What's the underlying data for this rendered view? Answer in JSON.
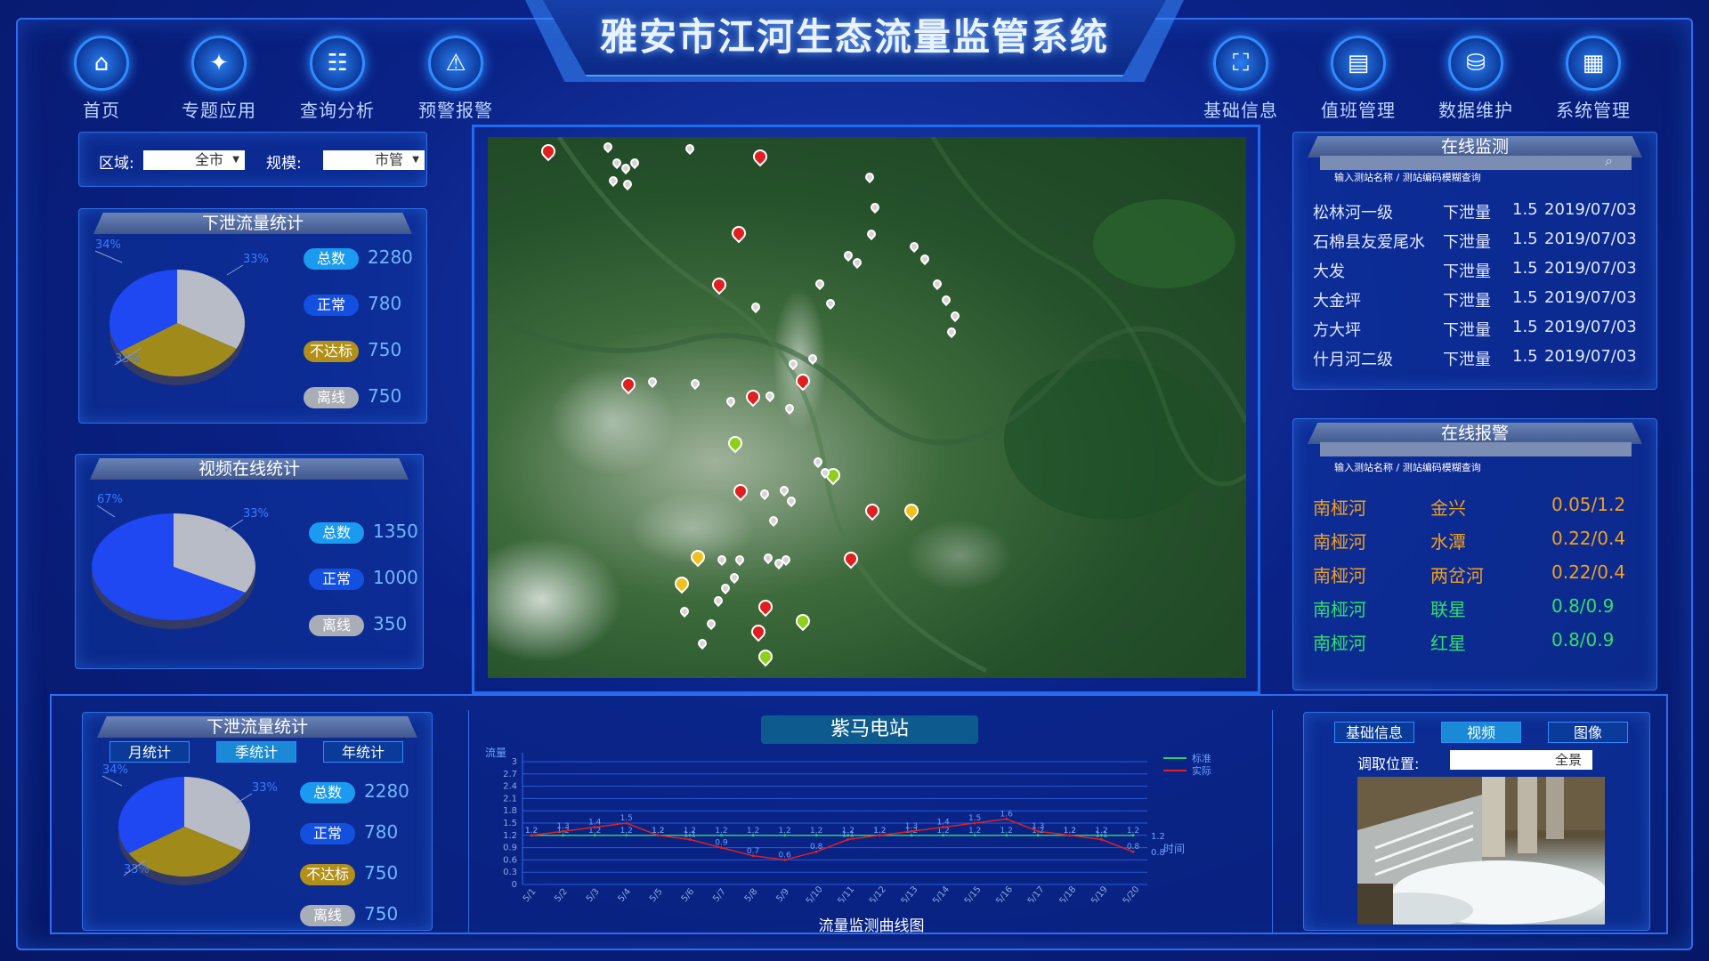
{
  "app": {
    "title": "雅安市江河生态流量监管系统"
  },
  "nav_left": [
    {
      "label": "首页",
      "icon": "home-icon",
      "glyph": "⌂"
    },
    {
      "label": "专题应用",
      "icon": "topic-icon",
      "glyph": "✦"
    },
    {
      "label": "查询分析",
      "icon": "query-icon",
      "glyph": "☷"
    },
    {
      "label": "预警报警",
      "icon": "alarm-icon",
      "glyph": "⚠"
    }
  ],
  "nav_right": [
    {
      "label": "基础信息",
      "icon": "info-icon",
      "glyph": "⛶"
    },
    {
      "label": "值班管理",
      "icon": "duty-icon",
      "glyph": "▤"
    },
    {
      "label": "数据维护",
      "icon": "database-icon",
      "glyph": "⛁"
    },
    {
      "label": "系统管理",
      "icon": "system-icon",
      "glyph": "▦"
    }
  ],
  "filter": {
    "region_label": "区域:",
    "region_value": "全市",
    "scale_label": "规模:",
    "scale_value": "市管"
  },
  "discharge": {
    "title": "下泄流量统计",
    "items": [
      {
        "label": "总数",
        "value": "2280"
      },
      {
        "label": "正常",
        "value": "780"
      },
      {
        "label": "不达标",
        "value": "750"
      },
      {
        "label": "离线",
        "value": "750"
      }
    ],
    "pie_labels": [
      "34%",
      "33%",
      "33%"
    ]
  },
  "video": {
    "title": "视频在线统计",
    "items": [
      {
        "label": "总数",
        "value": "1350"
      },
      {
        "label": "正常",
        "value": "1000"
      },
      {
        "label": "离线",
        "value": "350"
      }
    ],
    "pie_labels": [
      "67%",
      "33%"
    ]
  },
  "online_monitor": {
    "title": "在线监测",
    "search_placeholder": "输入测站名称 / 测站编码模糊查询",
    "rows": [
      {
        "station": "松林河一级",
        "type": "下泄量",
        "value": "1.5",
        "date": "2019/07/03"
      },
      {
        "station": "石棉县友爱尾水",
        "type": "下泄量",
        "value": "1.5",
        "date": "2019/07/03"
      },
      {
        "station": "大发",
        "type": "下泄量",
        "value": "1.5",
        "date": "2019/07/03"
      },
      {
        "station": "大金坪",
        "type": "下泄量",
        "value": "1.5",
        "date": "2019/07/03"
      },
      {
        "station": "方大坪",
        "type": "下泄量",
        "value": "1.5",
        "date": "2019/07/03"
      },
      {
        "station": "什月河二级",
        "type": "下泄量",
        "value": "1.5",
        "date": "2019/07/03"
      }
    ]
  },
  "online_alarm": {
    "title": "在线报警",
    "search_placeholder": "输入测站名称 / 测站编码模糊查询",
    "rows": [
      {
        "river": "南桠河",
        "station": "金兴",
        "value": "0.05/1.2",
        "color": "#f0a020"
      },
      {
        "river": "南桠河",
        "station": "水潭",
        "value": "0.22/0.4",
        "color": "#f0a020"
      },
      {
        "river": "南桠河",
        "station": "两岔河",
        "value": "0.22/0.4",
        "color": "#f0a020"
      },
      {
        "river": "南桠河",
        "station": "联星",
        "value": "0.8/0.9",
        "color": "#2ee06a"
      },
      {
        "river": "南桠河",
        "station": "红星",
        "value": "0.8/0.9",
        "color": "#2ee06a"
      }
    ]
  },
  "bottom_discharge": {
    "title": "下泄流量统计",
    "tabs": [
      "月统计",
      "季统计",
      "年统计"
    ],
    "active_tab": 1,
    "items": [
      {
        "label": "总数",
        "value": "2280"
      },
      {
        "label": "正常",
        "value": "780"
      },
      {
        "label": "不达标",
        "value": "750"
      },
      {
        "label": "离线",
        "value": "750"
      }
    ],
    "pie_labels": [
      "34%",
      "33%",
      "33%"
    ]
  },
  "station_chart": {
    "station": "紫马电站",
    "caption": "流量监测曲线图",
    "ylabel": "流量",
    "xlabel": "时间",
    "legend": [
      "标准",
      "实际"
    ]
  },
  "chart_data": {
    "type": "line",
    "ylim": [
      0,
      3
    ],
    "yticks": [
      "0",
      "0.3",
      "0.6",
      "0.9",
      "1.2",
      "1.5",
      "1.8",
      "2.1",
      "2.4",
      "2.7",
      "3"
    ],
    "categories": [
      "5/1",
      "5/2",
      "5/3",
      "5/4",
      "5/5",
      "5/6",
      "5/7",
      "5/8",
      "5/9",
      "5/10",
      "5/11",
      "5/12",
      "5/13",
      "5/14",
      "5/15",
      "5/16",
      "5/17",
      "5/18",
      "5/19",
      "5/20"
    ],
    "series": [
      {
        "name": "标准",
        "color": "#2ecf6a",
        "values": [
          1.2,
          1.2,
          1.2,
          1.2,
          1.2,
          1.2,
          1.2,
          1.2,
          1.2,
          1.2,
          1.2,
          1.2,
          1.2,
          1.2,
          1.2,
          1.2,
          1.2,
          1.2,
          1.2,
          1.2
        ],
        "labels": [
          "1.2",
          "1.2",
          "1.2",
          "1.2",
          "1.2",
          "1.2",
          "1.2",
          "1.2",
          "1.2",
          "1.2",
          "1.2",
          "1.2",
          "1.2",
          "1.2",
          "1.2",
          "1.2",
          "1.2",
          "1.2",
          "1.2",
          "1.2"
        ]
      },
      {
        "name": "实际",
        "color": "#e02020",
        "values": [
          1.2,
          1.3,
          1.4,
          1.5,
          1.2,
          1.1,
          0.9,
          0.7,
          0.6,
          0.8,
          1.1,
          1.2,
          1.3,
          1.4,
          1.5,
          1.6,
          1.3,
          1.2,
          1.1,
          0.8
        ],
        "labels": [
          "1.2",
          "1.3",
          "1.4",
          "1.5",
          "1.2",
          "1.1",
          "0.9",
          "0.7",
          "0.6",
          "0.8",
          "1.1",
          "1.2",
          "1.3",
          "1.4",
          "1.5",
          "1.6",
          "1.3",
          "1.2",
          "1.1",
          "0.8"
        ]
      }
    ],
    "grid": true,
    "legend_position": "top-right"
  },
  "camera": {
    "tabs": [
      "基础信息",
      "视频",
      "图像"
    ],
    "active_tab": 1,
    "position_label": "调取位置:",
    "position_value": "全景"
  },
  "colors": {
    "accent": "#2f8cff",
    "pie_blue": "#1f47f2",
    "pie_gray": "#b7bcc6",
    "pie_olive": "#a08a1a",
    "badge_cyan": "#1a9bf0",
    "badge_blue": "#1450e0",
    "badge_olive": "#b09018",
    "badge_gray": "#a8adb6"
  }
}
